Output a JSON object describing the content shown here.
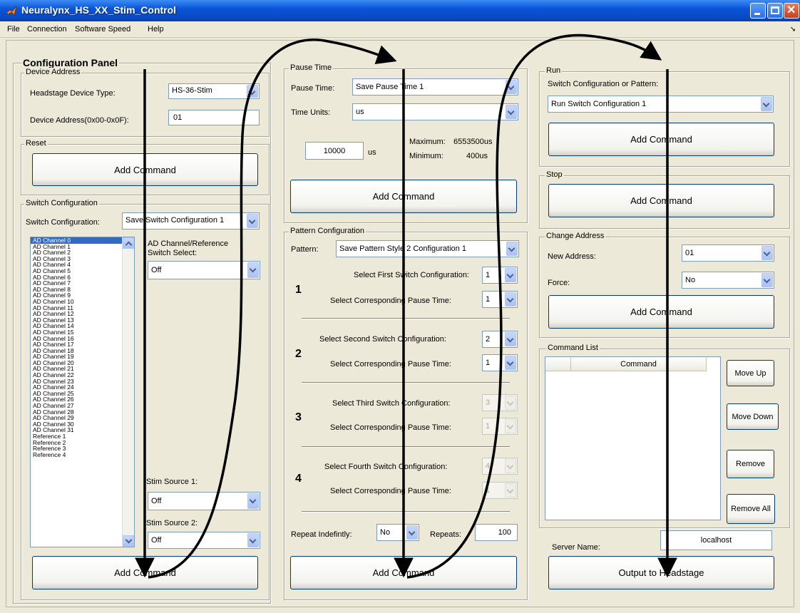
{
  "window": {
    "title": "Neuralynx_HS_XX_Stim_Control"
  },
  "menu": [
    "File",
    "Connection",
    "Software Speed",
    "Help"
  ],
  "config_panel": {
    "title": "Configuration Panel"
  },
  "device_address": {
    "legend": "Device Address",
    "type_label": "Headstage Device Type:",
    "type_value": "HS-36-Stim",
    "addr_label": "Device Address(0x00-0x0F):",
    "addr_value": "01"
  },
  "reset": {
    "legend": "Reset",
    "add_label": "Add Command"
  },
  "switch_config": {
    "legend": "Switch Configuration",
    "label": "Switch Configuration:",
    "value": "Save Switch Configuration 1",
    "channels": [
      "AD Channel 0",
      "AD Channel 1",
      "AD Channel 2",
      "AD Channel 3",
      "AD Channel 4",
      "AD Channel 5",
      "AD Channel 6",
      "AD Channel 7",
      "AD Channel 8",
      "AD Channel 9",
      "AD Channel 10",
      "AD Channel 11",
      "AD Channel 12",
      "AD Channel 13",
      "AD Channel 14",
      "AD Channel 15",
      "AD Channel 16",
      "AD Channel 17",
      "AD Channel 18",
      "AD Channel 19",
      "AD Channel 20",
      "AD Channel 21",
      "AD Channel 22",
      "AD Channel 23",
      "AD Channel 24",
      "AD Channel 25",
      "AD Channel 26",
      "AD Channel 27",
      "AD Channel 28",
      "AD Channel 29",
      "AD Channel 30",
      "AD Channel 31",
      "Reference 1",
      "Reference 2",
      "Reference 3",
      "Reference 4"
    ],
    "select_label": "AD Channel/Reference Switch Select:",
    "select_value": "Off",
    "stim1_label": "Stim Source 1:",
    "stim1_value": "Off",
    "stim2_label": "Stim Source 2:",
    "stim2_value": "Off",
    "add_label": "Add Command"
  },
  "pause_time": {
    "legend": "Pause Time",
    "label": "Pause Time:",
    "value": "Save Pause Time 1",
    "units_label": "Time Units:",
    "units_value": "us",
    "time_value": "10000",
    "time_unit": "us",
    "max_label": "Maximum:",
    "max_value": "6553500us",
    "min_label": "Minimum:",
    "min_value": "400us",
    "add_label": "Add Command"
  },
  "pattern": {
    "legend": "Pattern Configuration",
    "label": "Pattern:",
    "value": "Save Pattern Style 2 Configuration 1",
    "groups": [
      {
        "num": "1",
        "switch_label": "Select First Switch Configuration:",
        "switch_value": "1",
        "pause_label": "Select Corresponding Pause Time:",
        "pause_value": "1"
      },
      {
        "num": "2",
        "switch_label": "Select Second Switch Configuration:",
        "switch_value": "2",
        "pause_label": "Select Corresponding Pause Time:",
        "pause_value": "1"
      },
      {
        "num": "3",
        "switch_label": "Select Third Switch Configuration:",
        "switch_value": "3",
        "pause_label": "Select Corresponding Pause Time:",
        "pause_value": "1"
      },
      {
        "num": "4",
        "switch_label": "Select Fourth Switch Configuration:",
        "switch_value": "4",
        "pause_label": "Select Corresponding Pause Time:",
        "pause_value": "1"
      }
    ],
    "repeat_label": "Repeat Indefintly:",
    "repeat_value": "No",
    "repeats_label": "Repeats:",
    "repeats_value": "100",
    "add_label": "Add Command"
  },
  "run": {
    "legend": "Run",
    "label": "Switch Configuration or Pattern:",
    "value": "Run Switch Configuration 1",
    "add_label": "Add Command"
  },
  "stop": {
    "legend": "Stop",
    "add_label": "Add Command"
  },
  "change_address": {
    "legend": "Change Address",
    "new_label": "New Address:",
    "new_value": "01",
    "force_label": "Force:",
    "force_value": "No",
    "add_label": "Add Command"
  },
  "command_list": {
    "legend": "Command List",
    "column": "Command",
    "move_up": "Move Up",
    "move_down": "Move Down",
    "remove": "Remove",
    "remove_all": "Remove All"
  },
  "server": {
    "label": "Server Name:",
    "value": "localhost"
  },
  "output_label": "Output to Headstage"
}
